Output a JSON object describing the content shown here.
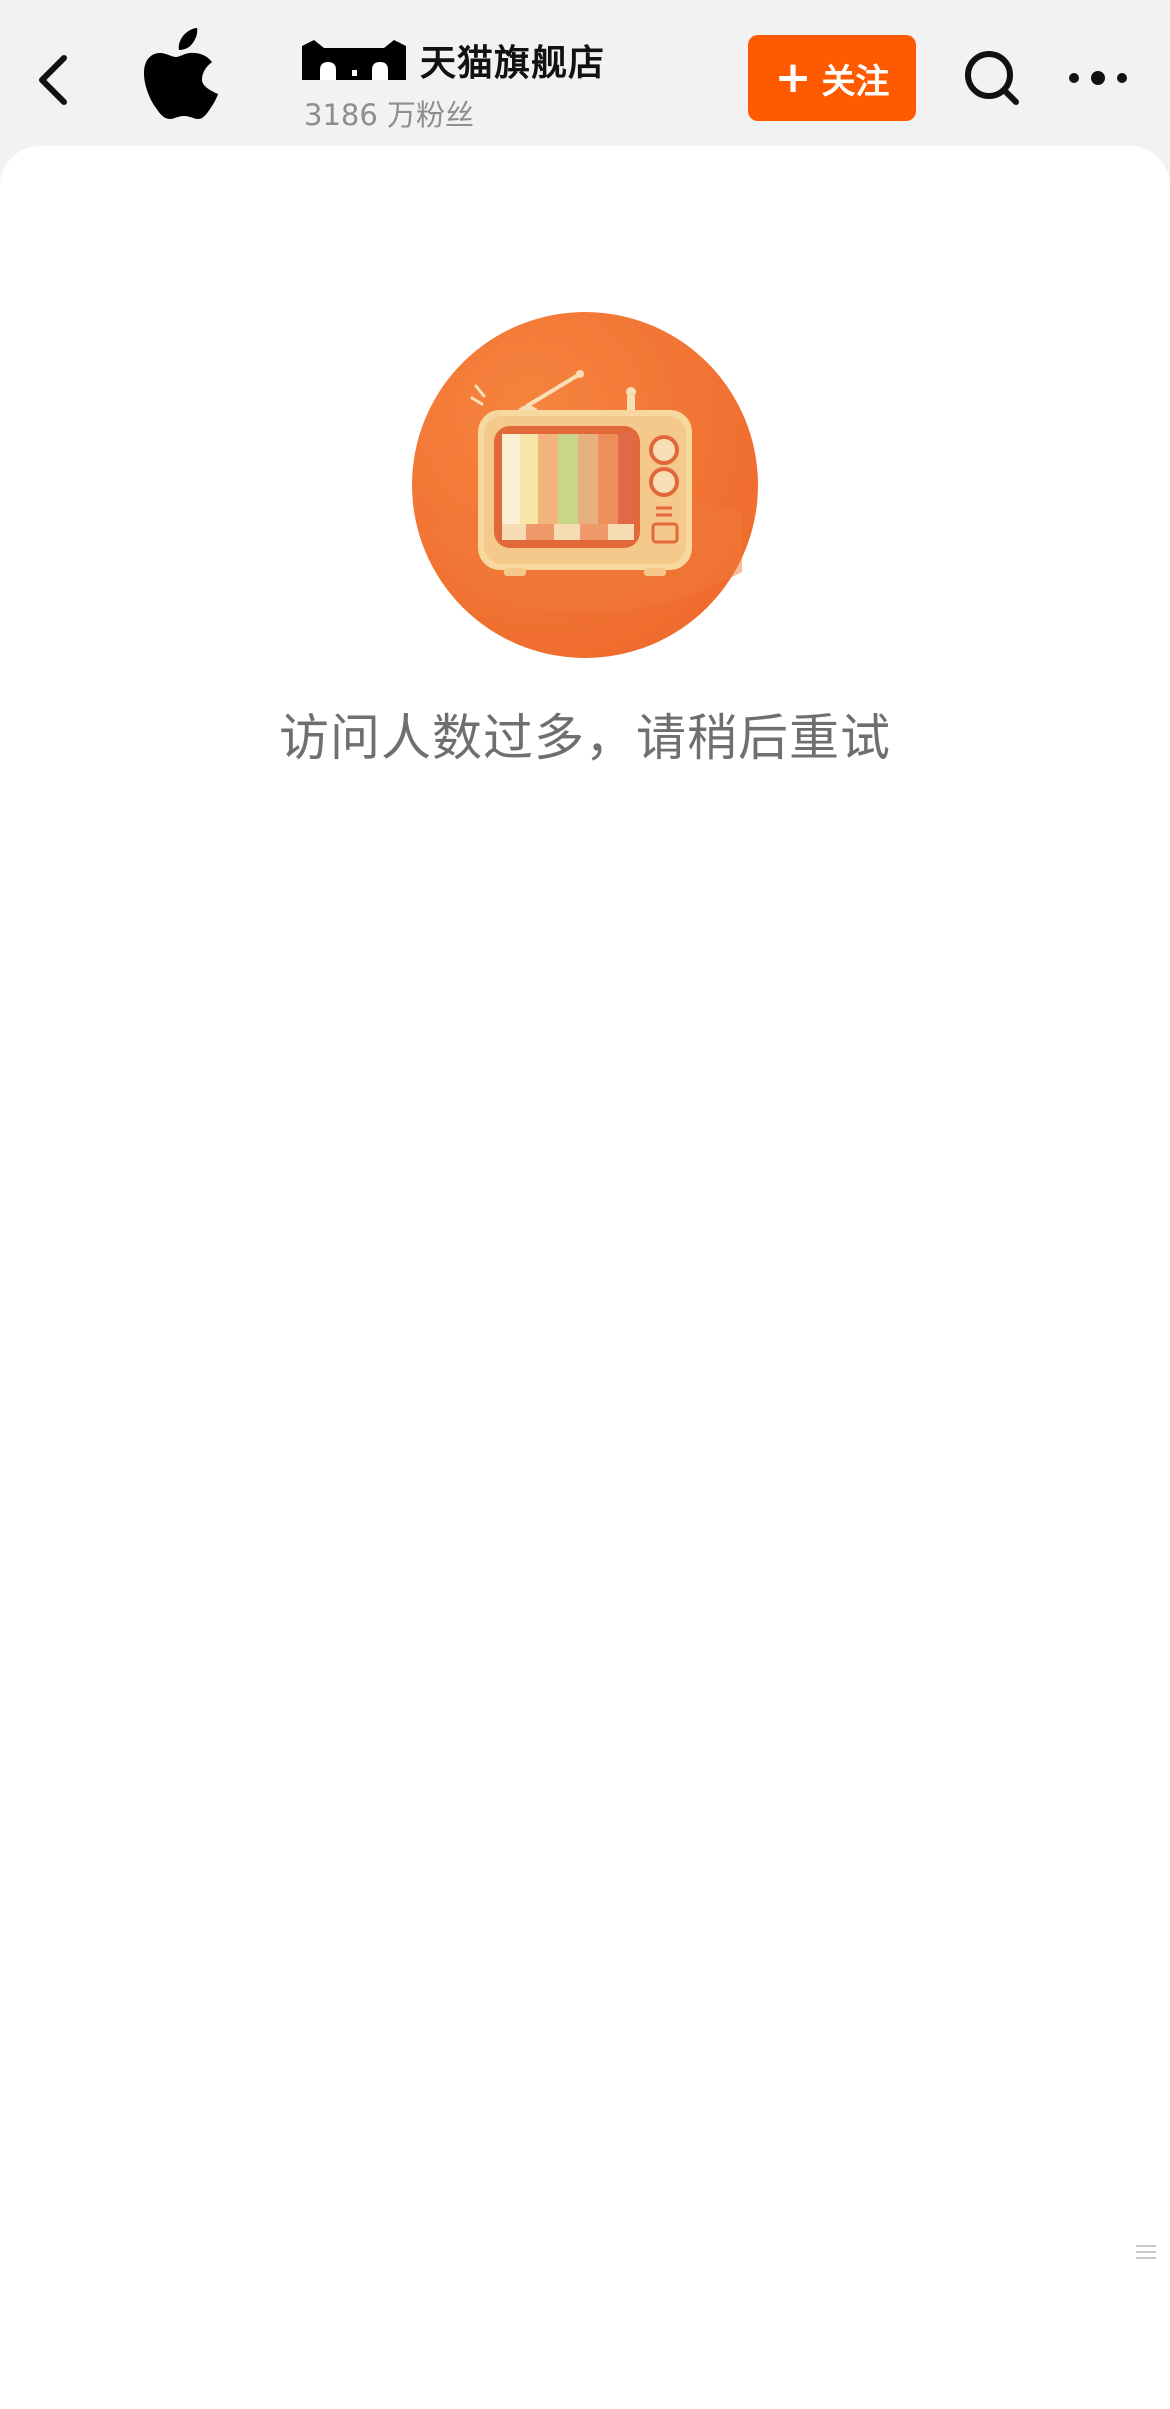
{
  "header": {
    "back_icon": "chevron-left-icon",
    "store_logo_icon": "apple-logo-icon",
    "brand_badge_icon": "tmall-cat-logo-icon",
    "store_name": "天猫旗舰店",
    "fans_count": "3186 万粉丝",
    "follow_label": "关注",
    "follow_plus": "+",
    "follow_color": "#ff5a00",
    "search_icon": "search-icon",
    "more_icon": "more-dots-icon"
  },
  "main": {
    "illustration_icon": "retro-tv-icon",
    "error_message": "访问人数过多，请稍后重试"
  }
}
